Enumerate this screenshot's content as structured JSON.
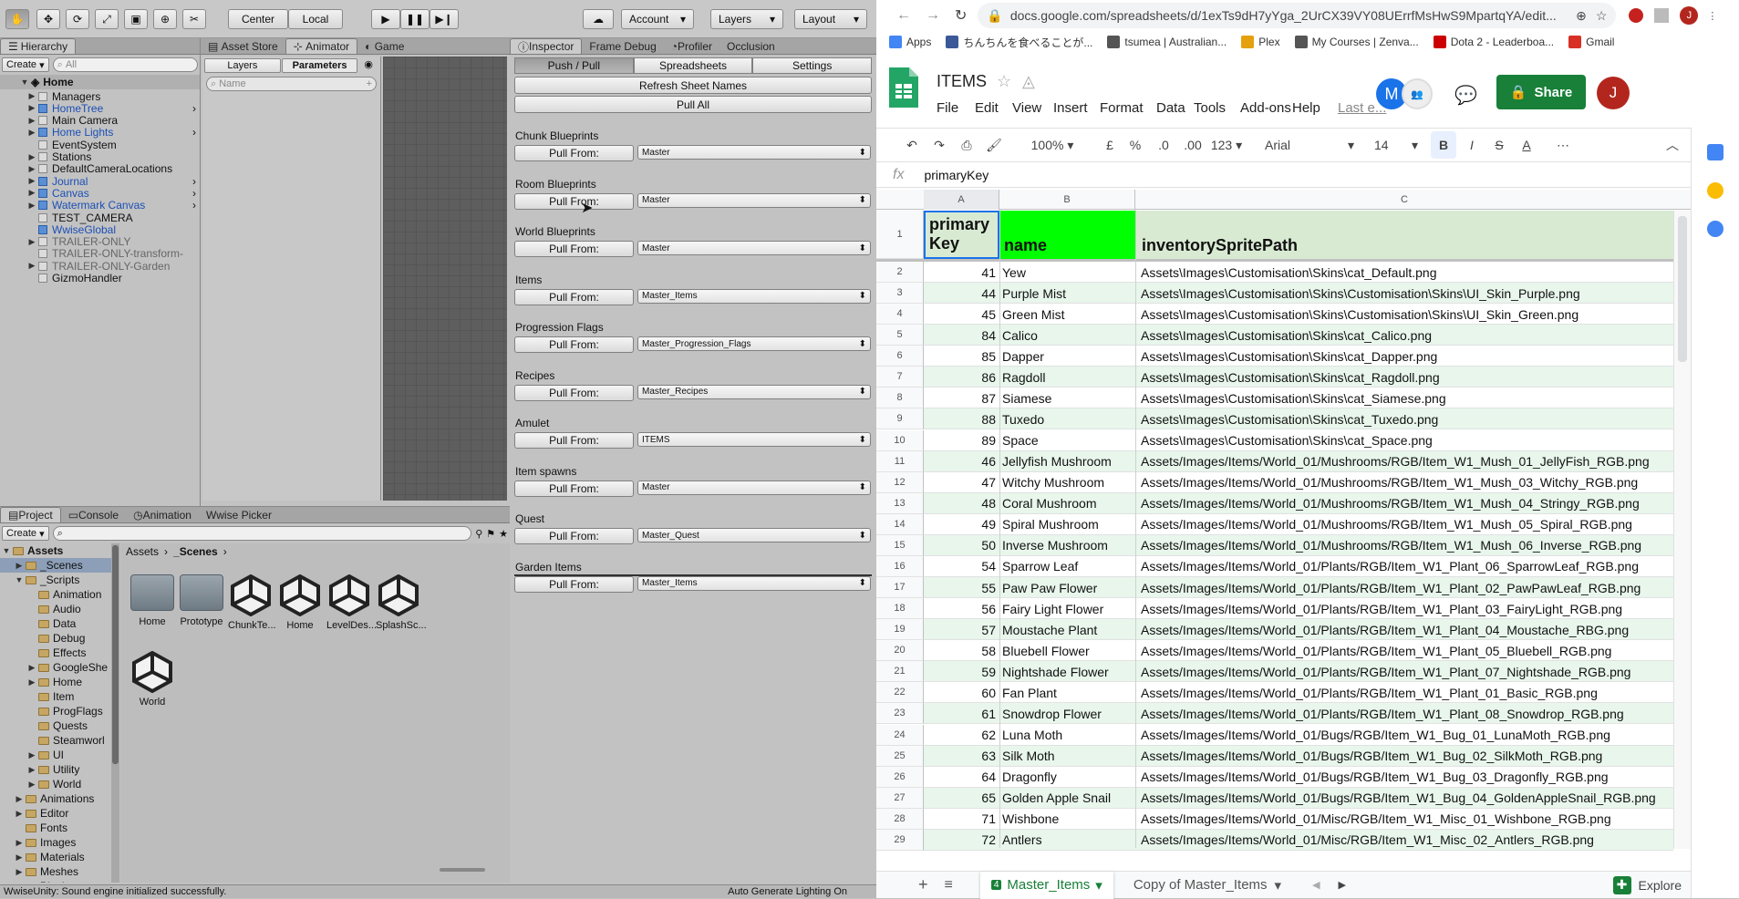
{
  "unity": {
    "toolbar": {
      "pivot_center": "Center",
      "pivot_local": "Local",
      "account": "Account",
      "layers": "Layers",
      "layout": "Layout"
    },
    "hierarchy": {
      "tab": "Hierarchy",
      "create": "Create",
      "search_placeholder": "All",
      "scene": "Home",
      "items": [
        {
          "label": "Managers",
          "style": "normal",
          "arrow": true
        },
        {
          "label": "HomeTree",
          "style": "blue",
          "arrow": true
        },
        {
          "label": "Main Camera",
          "style": "normal",
          "arrow": true
        },
        {
          "label": "Home Lights",
          "style": "blue",
          "arrow": true
        },
        {
          "label": "EventSystem",
          "style": "normal",
          "arrow": false
        },
        {
          "label": "Stations",
          "style": "normal",
          "arrow": true
        },
        {
          "label": "DefaultCameraLocations",
          "style": "normal",
          "arrow": true
        },
        {
          "label": "Journal",
          "style": "blue",
          "arrow": true
        },
        {
          "label": "Canvas",
          "style": "blue",
          "arrow": true
        },
        {
          "label": "Watermark Canvas",
          "style": "blue",
          "arrow": true
        },
        {
          "label": "TEST_CAMERA",
          "style": "normal",
          "arrow": false
        },
        {
          "label": "WwiseGlobal",
          "style": "blue",
          "arrow": false
        },
        {
          "label": "TRAILER-ONLY",
          "style": "gray",
          "arrow": true
        },
        {
          "label": "TRAILER-ONLY-transform-",
          "style": "gray",
          "arrow": false
        },
        {
          "label": "TRAILER-ONLY-Garden",
          "style": "gray",
          "arrow": true
        },
        {
          "label": "GizmoHandler",
          "style": "normal",
          "arrow": false
        }
      ]
    },
    "center_tabs": {
      "asset_store": "Asset Store",
      "animator": "Animator",
      "game": "Game",
      "layers": "Layers",
      "parameters": "Parameters",
      "name_placeholder": "Name"
    },
    "inspector": {
      "tabs": [
        "Inspector",
        "Frame Debug",
        "Profiler",
        "Occlusion"
      ],
      "subtabs": [
        "Push / Pull",
        "Spreadsheets",
        "Settings"
      ],
      "refresh": "Refresh Sheet Names",
      "pull_all": "Pull All",
      "pull_label": "Pull From:",
      "sections": [
        {
          "title": "Chunk Blueprints",
          "value": "Master"
        },
        {
          "title": "Room Blueprints",
          "value": "Master"
        },
        {
          "title": "World Blueprints",
          "value": "Master"
        },
        {
          "title": "Items",
          "value": "Master_Items"
        },
        {
          "title": "Progression Flags",
          "value": "Master_Progression_Flags"
        },
        {
          "title": "Recipes",
          "value": "Master_Recipes"
        },
        {
          "title": "Amulet",
          "value": "ITEMS"
        },
        {
          "title": "Item spawns",
          "value": "Master"
        },
        {
          "title": "Quest",
          "value": "Master_Quest"
        },
        {
          "title": "Garden Items",
          "value": "Master_Items"
        }
      ]
    },
    "project": {
      "tabs": [
        "Project",
        "Console",
        "Animation",
        "Wwise Picker"
      ],
      "create": "Create",
      "tree": [
        {
          "label": "Assets",
          "level": 0,
          "arrow": "down",
          "bold": true
        },
        {
          "label": "_Scenes",
          "level": 1,
          "arrow": "right",
          "selected": true
        },
        {
          "label": "_Scripts",
          "level": 1,
          "arrow": "down"
        },
        {
          "label": "Animation",
          "level": 2,
          "arrow": ""
        },
        {
          "label": "Audio",
          "level": 2,
          "arrow": ""
        },
        {
          "label": "Data",
          "level": 2,
          "arrow": ""
        },
        {
          "label": "Debug",
          "level": 2,
          "arrow": ""
        },
        {
          "label": "Effects",
          "level": 2,
          "arrow": ""
        },
        {
          "label": "GoogleShe",
          "level": 2,
          "arrow": "right"
        },
        {
          "label": "Home",
          "level": 2,
          "arrow": "right"
        },
        {
          "label": "Item",
          "level": 2,
          "arrow": ""
        },
        {
          "label": "ProgFlags",
          "level": 2,
          "arrow": ""
        },
        {
          "label": "Quests",
          "level": 2,
          "arrow": ""
        },
        {
          "label": "Steamworl",
          "level": 2,
          "arrow": ""
        },
        {
          "label": "UI",
          "level": 2,
          "arrow": "right"
        },
        {
          "label": "Utility",
          "level": 2,
          "arrow": "right"
        },
        {
          "label": "World",
          "level": 2,
          "arrow": "right"
        },
        {
          "label": "Animations",
          "level": 1,
          "arrow": "right"
        },
        {
          "label": "Editor",
          "level": 1,
          "arrow": "right"
        },
        {
          "label": "Fonts",
          "level": 1,
          "arrow": ""
        },
        {
          "label": "Images",
          "level": 1,
          "arrow": "right"
        },
        {
          "label": "Materials",
          "level": 1,
          "arrow": "right"
        },
        {
          "label": "Meshes",
          "level": 1,
          "arrow": "right"
        },
        {
          "label": "Plugins",
          "level": 1,
          "arrow": "right"
        }
      ],
      "breadcrumb": [
        "Assets",
        "_Scenes"
      ],
      "assets": [
        {
          "label": "Home",
          "kind": "folder"
        },
        {
          "label": "Prototype",
          "kind": "folder"
        },
        {
          "label": "ChunkTe...",
          "kind": "unity"
        },
        {
          "label": "Home",
          "kind": "unity"
        },
        {
          "label": "LevelDes...",
          "kind": "unity"
        },
        {
          "label": "SplashSc...",
          "kind": "unity"
        },
        {
          "label": "World",
          "kind": "unity"
        }
      ]
    },
    "status_left": "WwiseUnity: Sound engine initialized successfully.",
    "status_right": "Auto Generate Lighting On"
  },
  "browser": {
    "url": "docs.google.com/spreadsheets/d/1exTs9dH7yYga_2UrCX39VY08UErrfMsHwS9MpartqYA/edit...",
    "bookmarks": [
      "Apps",
      "ちんちんを食べることが...",
      "tsumea | Australian...",
      "Plex",
      "My Courses | Zenva...",
      "Dota 2 - Leaderboa...",
      "Gmail"
    ],
    "account_initial": "J"
  },
  "sheets": {
    "title": "ITEMS",
    "menu": [
      "File",
      "Edit",
      "View",
      "Insert",
      "Format",
      "Data",
      "Tools",
      "Add-ons",
      "Help"
    ],
    "last_edit": "Last e...",
    "share": "Share",
    "avatar_m": "M",
    "toolbar": {
      "zoom": "100%",
      "currency": "£",
      "percent": "%",
      "dec_less": ".0",
      "dec_more": ".00",
      "format": "123",
      "font": "Arial",
      "size": "14"
    },
    "formula_value": "primaryKey",
    "col_headers": [
      "A",
      "B",
      "C"
    ],
    "header_row": {
      "a": "primary Key",
      "b": "name",
      "c": "inventorySpritePath"
    },
    "rows": [
      {
        "n": "2",
        "a": "41",
        "b": "Yew",
        "c": "Assets\\Images\\Customisation\\Skins\\cat_Default.png"
      },
      {
        "n": "3",
        "a": "44",
        "b": "Purple Mist",
        "c": "Assets\\Images\\Customisation\\Skins\\Customisation\\Skins\\UI_Skin_Purple.png"
      },
      {
        "n": "4",
        "a": "45",
        "b": "Green Mist",
        "c": "Assets\\Images\\Customisation\\Skins\\Customisation\\Skins\\UI_Skin_Green.png"
      },
      {
        "n": "5",
        "a": "84",
        "b": "Calico",
        "c": "Assets\\Images\\Customisation\\Skins\\cat_Calico.png"
      },
      {
        "n": "6",
        "a": "85",
        "b": "Dapper",
        "c": "Assets\\Images\\Customisation\\Skins\\cat_Dapper.png"
      },
      {
        "n": "7",
        "a": "86",
        "b": "Ragdoll",
        "c": "Assets\\Images\\Customisation\\Skins\\cat_Ragdoll.png"
      },
      {
        "n": "8",
        "a": "87",
        "b": "Siamese",
        "c": "Assets\\Images\\Customisation\\Skins\\cat_Siamese.png"
      },
      {
        "n": "9",
        "a": "88",
        "b": "Tuxedo",
        "c": "Assets\\Images\\Customisation\\Skins\\cat_Tuxedo.png"
      },
      {
        "n": "10",
        "a": "89",
        "b": "Space",
        "c": "Assets\\Images\\Customisation\\Skins\\cat_Space.png"
      },
      {
        "n": "11",
        "a": "46",
        "b": "Jellyfish Mushroom",
        "c": "Assets/Images/Items/World_01/Mushrooms/RGB/Item_W1_Mush_01_JellyFish_RGB.png"
      },
      {
        "n": "12",
        "a": "47",
        "b": "Witchy Mushroom",
        "c": "Assets/Images/Items/World_01/Mushrooms/RGB/Item_W1_Mush_03_Witchy_RGB.png"
      },
      {
        "n": "13",
        "a": "48",
        "b": "Coral Mushroom",
        "c": "Assets/Images/Items/World_01/Mushrooms/RGB/Item_W1_Mush_04_Stringy_RGB.png"
      },
      {
        "n": "14",
        "a": "49",
        "b": "Spiral Mushroom",
        "c": "Assets/Images/Items/World_01/Mushrooms/RGB/Item_W1_Mush_05_Spiral_RGB.png"
      },
      {
        "n": "15",
        "a": "50",
        "b": "Inverse Mushroom",
        "c": "Assets/Images/Items/World_01/Mushrooms/RGB/Item_W1_Mush_06_Inverse_RGB.png"
      },
      {
        "n": "16",
        "a": "54",
        "b": "Sparrow Leaf",
        "c": "Assets/Images/Items/World_01/Plants/RGB/Item_W1_Plant_06_SparrowLeaf_RGB.png"
      },
      {
        "n": "17",
        "a": "55",
        "b": "Paw Paw Flower",
        "c": "Assets/Images/Items/World_01/Plants/RGB/Item_W1_Plant_02_PawPawLeaf_RGB.png"
      },
      {
        "n": "18",
        "a": "56",
        "b": "Fairy Light Flower",
        "c": "Assets/Images/Items/World_01/Plants/RGB/Item_W1_Plant_03_FairyLight_RGB.png"
      },
      {
        "n": "19",
        "a": "57",
        "b": "Moustache Plant",
        "c": "Assets/Images/Items/World_01/Plants/RGB/Item_W1_Plant_04_Moustache_RBG.png"
      },
      {
        "n": "20",
        "a": "58",
        "b": "Bluebell Flower",
        "c": "Assets/Images/Items/World_01/Plants/RGB/Item_W1_Plant_05_Bluebell_RGB.png"
      },
      {
        "n": "21",
        "a": "59",
        "b": "Nightshade Flower",
        "c": "Assets/Images/Items/World_01/Plants/RGB/Item_W1_Plant_07_Nightshade_RGB.png"
      },
      {
        "n": "22",
        "a": "60",
        "b": "Fan Plant",
        "c": "Assets/Images/Items/World_01/Plants/RGB/Item_W1_Plant_01_Basic_RGB.png"
      },
      {
        "n": "23",
        "a": "61",
        "b": "Snowdrop Flower",
        "c": "Assets/Images/Items/World_01/Plants/RGB/Item_W1_Plant_08_Snowdrop_RGB.png"
      },
      {
        "n": "24",
        "a": "62",
        "b": "Luna Moth",
        "c": "Assets/Images/Items/World_01/Bugs/RGB/Item_W1_Bug_01_LunaMoth_RGB.png"
      },
      {
        "n": "25",
        "a": "63",
        "b": "Silk Moth",
        "c": "Assets/Images/Items/World_01/Bugs/RGB/Item_W1_Bug_02_SilkMoth_RGB.png"
      },
      {
        "n": "26",
        "a": "64",
        "b": "Dragonfly",
        "c": "Assets/Images/Items/World_01/Bugs/RGB/Item_W1_Bug_03_Dragonfly_RGB.png"
      },
      {
        "n": "27",
        "a": "65",
        "b": "Golden Apple Snail",
        "c": "Assets/Images/Items/World_01/Bugs/RGB/Item_W1_Bug_04_GoldenAppleSnail_RGB.png"
      },
      {
        "n": "28",
        "a": "71",
        "b": "Wishbone",
        "c": "Assets/Images/Items/World_01/Misc/RGB/Item_W1_Misc_01_Wishbone_RGB.png"
      },
      {
        "n": "29",
        "a": "72",
        "b": "Antlers",
        "c": "Assets/Images/Items/World_01/Misc/RGB/Item_W1_Misc_02_Antlers_RGB.png"
      }
    ],
    "sheet_tabs": [
      "Master_Items",
      "Copy of Master_Items"
    ],
    "explore": "Explore",
    "colors": {
      "header_green": "#00ff00",
      "header_band": "#d9ead3",
      "row_alt": "#e8f6ec",
      "sheets_green": "#188038"
    }
  }
}
